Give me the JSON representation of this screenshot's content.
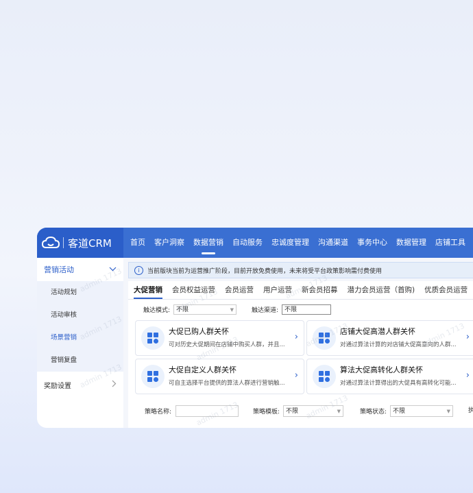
{
  "app": {
    "name": "客道CRM"
  },
  "nav": {
    "items": [
      "首页",
      "客户洞察",
      "数据营销",
      "自动服务",
      "忠诚度管理",
      "沟通渠道",
      "事务中心",
      "数据管理",
      "店铺工具"
    ],
    "active": "数据营销"
  },
  "sidebar": {
    "group1": "营销活动",
    "items": [
      "活动规划",
      "活动审核",
      "场景营销",
      "营销复盘"
    ],
    "active_item": "场景营销",
    "group2": "奖励设置"
  },
  "notice": "当前版块当前为运营推广阶段，目前开放免费使用，未来将受平台政策影响需付费使用",
  "tabs": {
    "items": [
      "大促营销",
      "会员权益运营",
      "会员运营",
      "用户运营",
      "新会员招募",
      "潜力会员运营（首购)",
      "优质会员运营"
    ],
    "active": "大促营销"
  },
  "filters": {
    "mode_label": "触达模式:",
    "mode_value": "不限",
    "channel_label": "触达渠道:",
    "channel_value": "不限"
  },
  "scenes": [
    {
      "title": "大促已购人群关怀",
      "desc": "可对历史大促期间在店铺中购买人群，并且..."
    },
    {
      "title": "店铺大促高潜人群关怀",
      "desc": "对通过算法计算的对店铺大促高意向的人群..."
    },
    {
      "title": "大促自定义人群关怀",
      "desc": "可自主选择平台提供的算法人群进行营销触..."
    },
    {
      "title": "算法大促高转化人群关怀",
      "desc": "对通过算法计算得出的大促具有高转化可能..."
    }
  ],
  "strategy": {
    "name_label": "策略名称:",
    "template_label": "策略模板:",
    "template_value": "不限",
    "status_label": "策略状态:",
    "status_value": "不限",
    "extra_label": "执"
  },
  "watermark": "admin 1713",
  "colors": {
    "primary": "#3a6fd2",
    "logo_bg": "#2b5ec9"
  }
}
